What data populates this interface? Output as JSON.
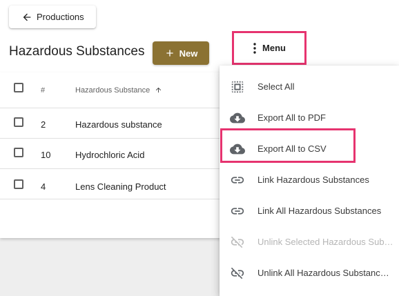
{
  "header": {
    "back_label": "Productions",
    "title": "Hazardous Substances",
    "new_label": "New",
    "menu_label": "Menu"
  },
  "table": {
    "columns": [
      "#",
      "Hazardous Substance"
    ],
    "rows": [
      {
        "num": "2",
        "name": "Hazardous substance"
      },
      {
        "num": "10",
        "name": "Hydrochloric Acid"
      },
      {
        "num": "4",
        "name": "Lens Cleaning Product"
      }
    ]
  },
  "menu": {
    "items": [
      {
        "label": "Select All",
        "icon": "select-all-icon",
        "disabled": false
      },
      {
        "label": "Export All to PDF",
        "icon": "cloud-download-icon",
        "disabled": false
      },
      {
        "label": "Export All to CSV",
        "icon": "cloud-download-icon",
        "disabled": false
      },
      {
        "label": "Link Hazardous Substances",
        "icon": "link-icon",
        "disabled": false
      },
      {
        "label": "Link All Hazardous Substances",
        "icon": "link-icon",
        "disabled": false
      },
      {
        "label": "Unlink Selected Hazardous Sub…",
        "icon": "link-off-icon",
        "disabled": true
      },
      {
        "label": "Unlink All Hazardous Substanc…",
        "icon": "link-off-icon",
        "disabled": false
      }
    ]
  },
  "colors": {
    "accent": "#8b7233",
    "highlight": "#e6336f",
    "icon": "#5f6368",
    "icon_disabled": "#bdbdbd"
  }
}
